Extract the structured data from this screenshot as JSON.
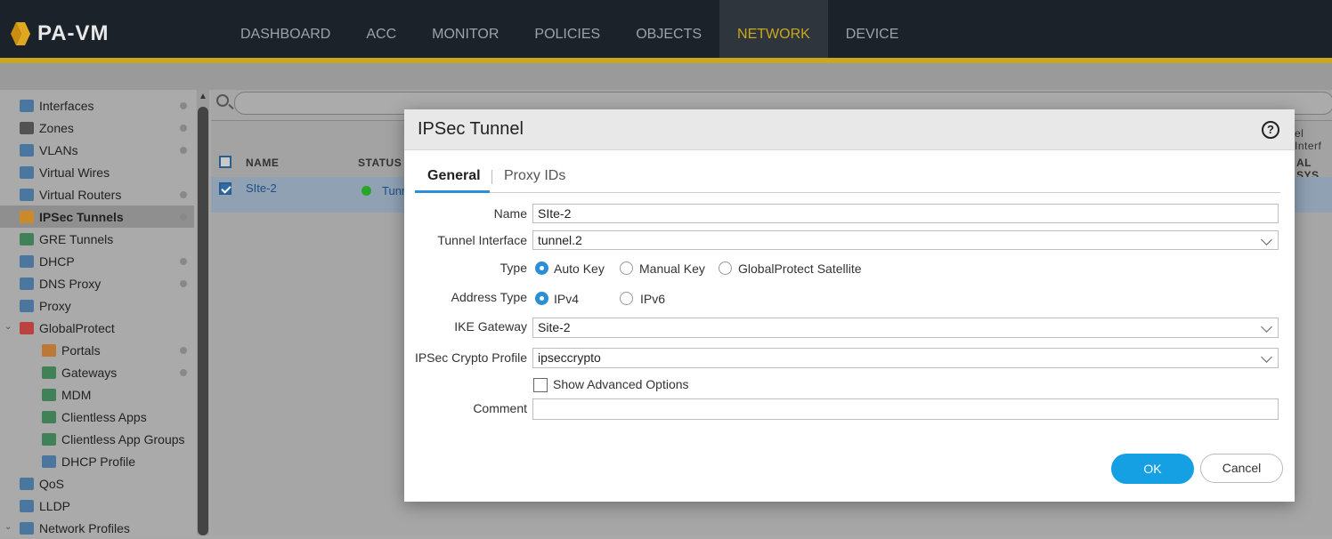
{
  "app": {
    "logo_text": "PA-VM"
  },
  "nav": [
    "DASHBOARD",
    "ACC",
    "MONITOR",
    "POLICIES",
    "OBJECTS",
    "NETWORK",
    "DEVICE"
  ],
  "nav_active": "NETWORK",
  "sidebar": {
    "items": [
      {
        "label": "Interfaces",
        "dot": true
      },
      {
        "label": "Zones",
        "dot": true
      },
      {
        "label": "VLANs",
        "dot": true
      },
      {
        "label": "Virtual Wires",
        "dot": false
      },
      {
        "label": "Virtual Routers",
        "dot": true
      },
      {
        "label": "IPSec Tunnels",
        "dot": true,
        "active": true
      },
      {
        "label": "GRE Tunnels",
        "dot": false
      },
      {
        "label": "DHCP",
        "dot": true
      },
      {
        "label": "DNS Proxy",
        "dot": true
      },
      {
        "label": "Proxy",
        "dot": false
      },
      {
        "label": "GlobalProtect",
        "dot": false,
        "caret": true
      },
      {
        "label": "Portals",
        "dot": true,
        "indent": true
      },
      {
        "label": "Gateways",
        "dot": true,
        "indent": true
      },
      {
        "label": "MDM",
        "dot": false,
        "indent": true
      },
      {
        "label": "Clientless Apps",
        "dot": false,
        "indent": true
      },
      {
        "label": "Clientless App Groups",
        "dot": false,
        "indent": true
      },
      {
        "label": "DHCP Profile",
        "dot": false,
        "indent": true
      },
      {
        "label": "QoS",
        "dot": false
      },
      {
        "label": "LLDP",
        "dot": false
      },
      {
        "label": "Network Profiles",
        "dot": false,
        "caret": true
      }
    ]
  },
  "table": {
    "headers": {
      "name": "NAME",
      "status": "STATUS",
      "col_right_top": "el Interf",
      "col_right_bottom": "AL SYS"
    },
    "row": {
      "name": "SIte-2",
      "status_text": "Tunn"
    }
  },
  "modal": {
    "title": "IPSec Tunnel",
    "help_label": "?",
    "tabs": {
      "general": "General",
      "proxy": "Proxy IDs"
    },
    "fields": {
      "name_label": "Name",
      "name_value": "SIte-2",
      "tunnel_label": "Tunnel Interface",
      "tunnel_value": "tunnel.2",
      "type_label": "Type",
      "type_options": [
        "Auto Key",
        "Manual Key",
        "GlobalProtect Satellite"
      ],
      "type_selected": "Auto Key",
      "addr_label": "Address Type",
      "addr_options": [
        "IPv4",
        "IPv6"
      ],
      "addr_selected": "IPv4",
      "ike_label": "IKE Gateway",
      "ike_value": "Site-2",
      "crypto_label": "IPSec Crypto Profile",
      "crypto_value": "ipseccrypto",
      "advanced_label": "Show Advanced Options",
      "comment_label": "Comment",
      "comment_value": ""
    },
    "buttons": {
      "ok": "OK",
      "cancel": "Cancel"
    }
  },
  "colors": {
    "accent": "#c9a81c",
    "primary": "#14a0e3",
    "topbar": "#1b222a"
  }
}
